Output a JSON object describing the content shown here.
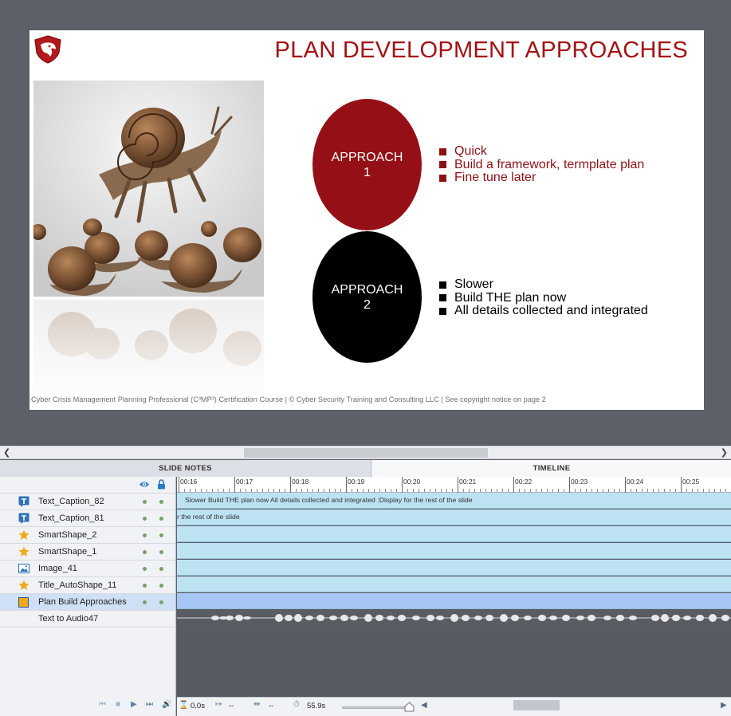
{
  "slide": {
    "title": "PLAN DEVELOPMENT APPROACHES",
    "approach1": {
      "line1": "APPROACH",
      "line2": "1",
      "bullets": [
        "Quick",
        "Build a framework, termplate plan",
        "Fine tune later"
      ]
    },
    "approach2": {
      "line1": "APPROACH",
      "line2": "2",
      "bullets": [
        "Slower",
        "Build THE plan now",
        "All details collected and integrated"
      ]
    },
    "footer": "Cyber Crisis Management Planning Professional (C³MP³) Certification Course | © Cyber Security Training and Consulting LLC | See copyright notice on page 2",
    "colors": {
      "title": "#a41114",
      "approach1": "#951016",
      "approach2": "#000000"
    }
  },
  "panel_tabs": {
    "notes": "SLIDE NOTES",
    "timeline": "TIMELINE"
  },
  "layers": [
    {
      "name": "Text_Caption_82",
      "icon": "text-caption-icon"
    },
    {
      "name": "Text_Caption_81",
      "icon": "text-caption-icon"
    },
    {
      "name": "SmartShape_2",
      "icon": "star-icon"
    },
    {
      "name": "SmartShape_1",
      "icon": "star-icon"
    },
    {
      "name": "Image_41",
      "icon": "image-icon"
    },
    {
      "name": "Title_AutoShape_11",
      "icon": "star-icon"
    },
    {
      "name": "Plan Build Approaches",
      "icon": "slide-icon",
      "selected": true
    },
    {
      "name": "Text to Audio47",
      "icon": ""
    }
  ],
  "ruler": [
    "00:16",
    "00:17",
    "00:18",
    "00:19",
    "00:20",
    "00:21",
    "00:22",
    "00:23",
    "00:24",
    "00:25"
  ],
  "tracks": {
    "caption82": "Slower Build THE plan now All details collected and integrated :Display for the rest of the slide",
    "caption81": "r the rest of the slide"
  },
  "controls": {
    "elapsed": "0.0s",
    "start": "--",
    "duration": "--",
    "total": "55.9s"
  }
}
